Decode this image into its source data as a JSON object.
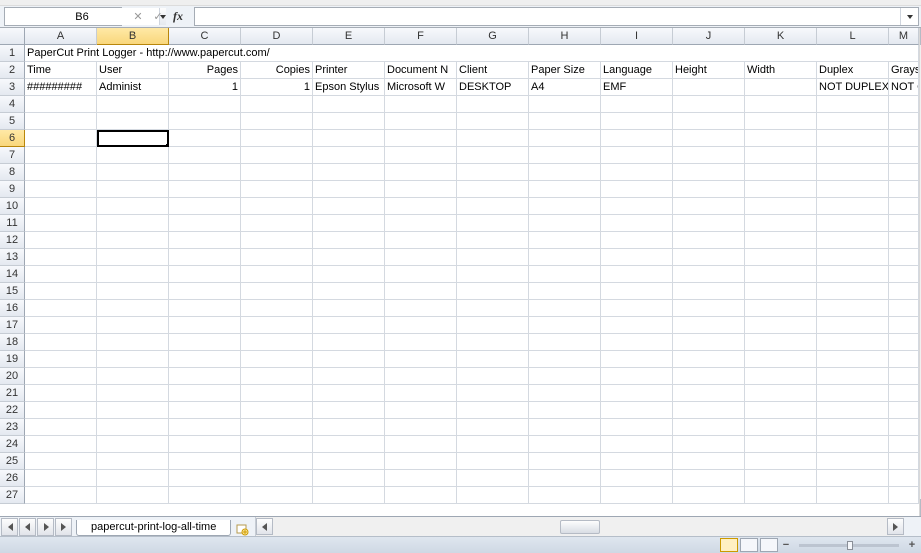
{
  "name_box": "B6",
  "formula_value": "",
  "columns": [
    "A",
    "B",
    "C",
    "D",
    "E",
    "F",
    "G",
    "H",
    "I",
    "J",
    "K",
    "L",
    "M"
  ],
  "active_col_index": 1,
  "row_count": 27,
  "active_row": 6,
  "selected_cell": "B6",
  "rows": {
    "1": {
      "A_span": "PaperCut Print Logger - http://www.papercut.com/"
    },
    "2": {
      "A": "Time",
      "B": "User",
      "C": "Pages",
      "D": "Copies",
      "E": "Printer",
      "F": "Document N",
      "G": "Client",
      "H": "Paper Size",
      "I": "Language",
      "J": "Height",
      "K": "Width",
      "L": "Duplex",
      "M": "Grays"
    },
    "3": {
      "A": "#########",
      "B": "Administ",
      "C": "1",
      "D": "1",
      "E": "Epson Stylus",
      "F": "Microsoft W",
      "G": "DESKTOP",
      "H": "A4",
      "I": "EMF",
      "J": "",
      "K": "",
      "L": "NOT DUPLEX",
      "M": "NOT G"
    }
  },
  "num_cols": [
    "C",
    "D"
  ],
  "sheet_tabs": [
    "papercut-print-log-all-time"
  ],
  "active_tab": 0
}
